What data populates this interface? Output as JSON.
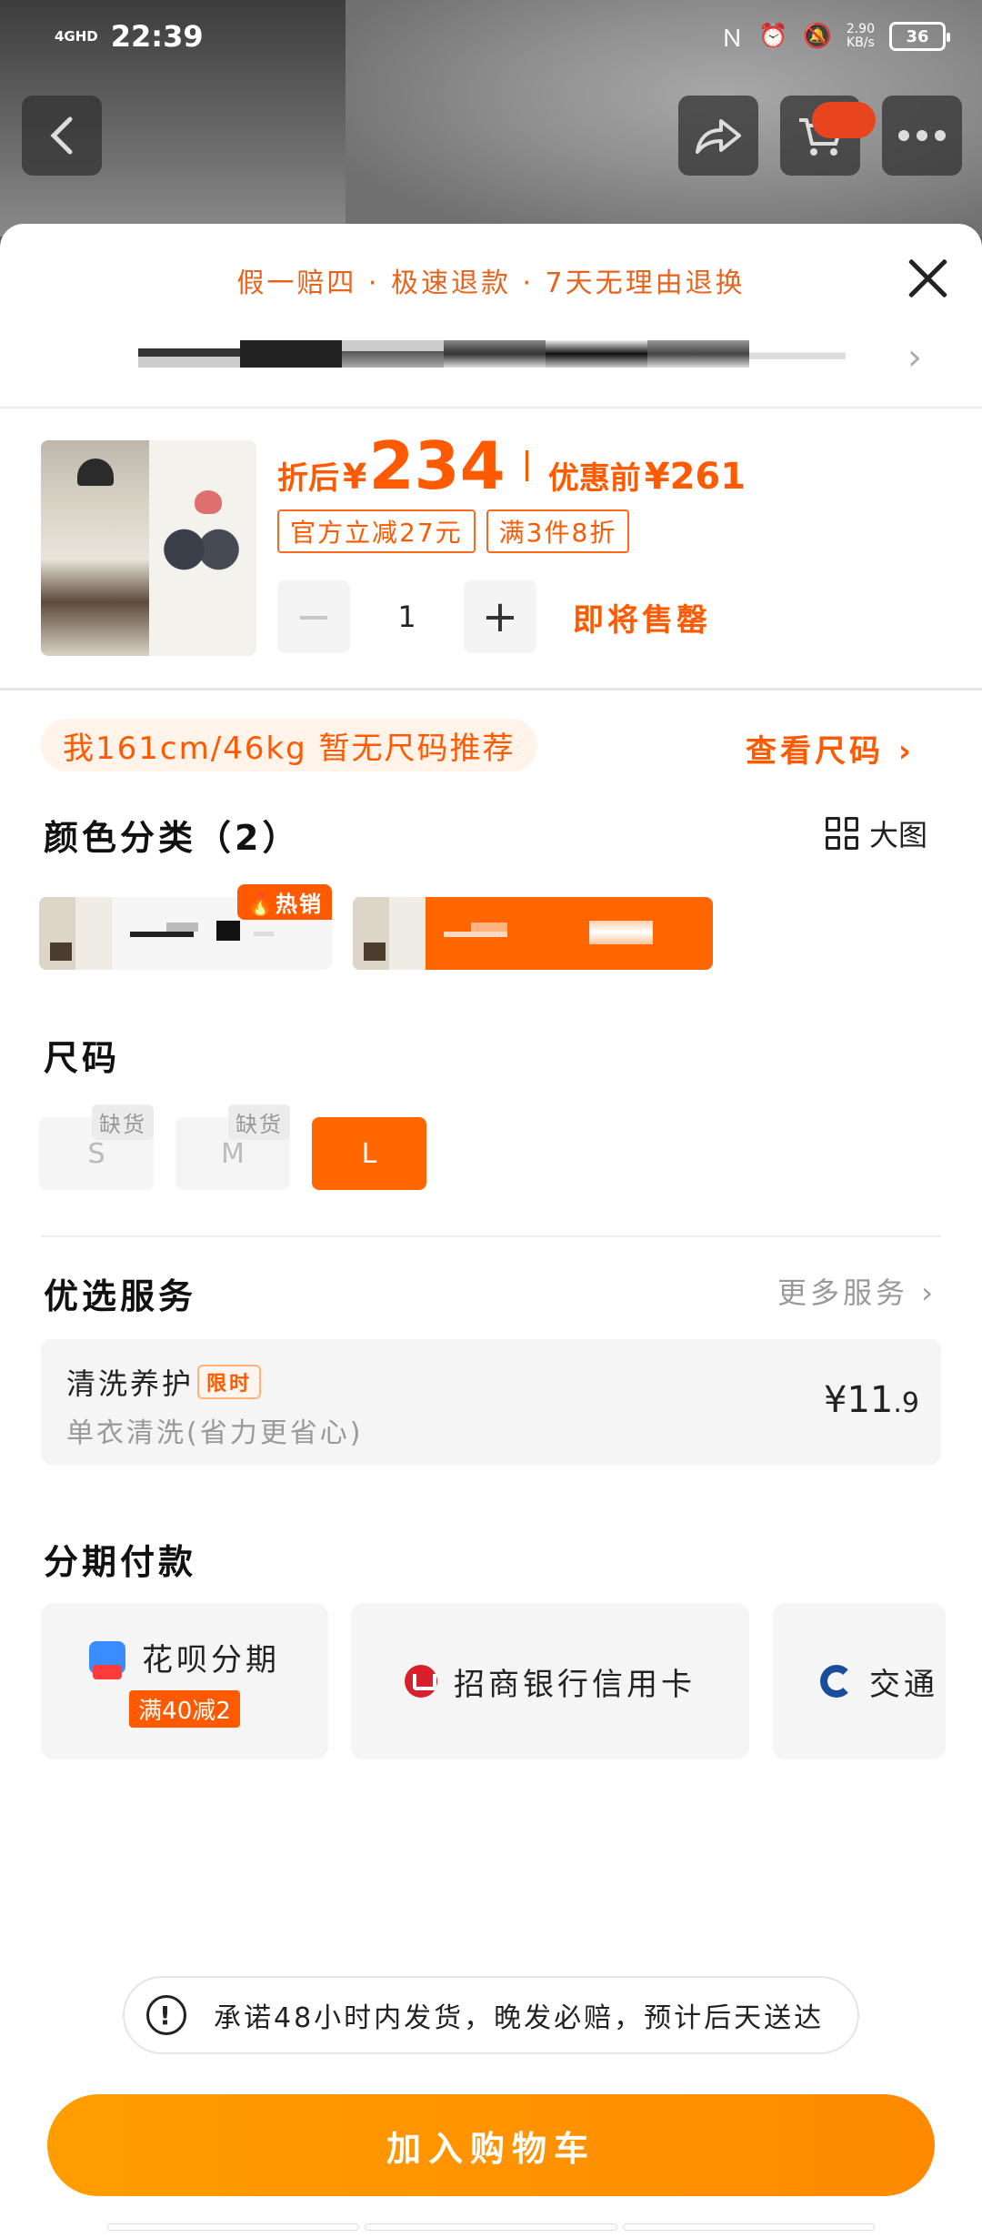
{
  "status_bar": {
    "network": "4GHD",
    "time": "22:39",
    "speed_value": "2.90",
    "speed_unit": "KB/s",
    "battery": "36"
  },
  "sheet": {
    "promise": "假一赔四 · 极速退款 · 7天无理由退换"
  },
  "product": {
    "price_prefix": "折后",
    "currency": "¥",
    "price": "234",
    "orig_prefix": "优惠前",
    "orig_price": "261",
    "tags": [
      "官方立减27元",
      "满3件8折"
    ],
    "quantity": "1",
    "minus": "−",
    "plus": "+",
    "status": "即将售罄"
  },
  "size_tip": "我161cm/46kg 暂无尺码推荐",
  "size_link": "查看尺码",
  "color_section": {
    "title": "颜色分类（2）",
    "big_pic_label": "大图",
    "hot_badge": "热销"
  },
  "size_section": {
    "title": "尺码",
    "sizes": [
      {
        "label": "S",
        "badge": "缺货"
      },
      {
        "label": "M",
        "badge": "缺货"
      },
      {
        "label": "L",
        "badge": ""
      }
    ]
  },
  "service_section": {
    "title": "优选服务",
    "more": "更多服务",
    "item_name": "清洗养护",
    "item_badge": "限时",
    "item_desc": "单衣清洗(省力更省心)",
    "item_price_main": "¥11",
    "item_price_decimal": ".9"
  },
  "installment_section": {
    "title": "分期付款",
    "options": [
      {
        "name": "花呗分期",
        "sub": "满40减2",
        "icon": "huabei-icon"
      },
      {
        "name": "招商银行信用卡",
        "icon": "cmb-bank-icon"
      },
      {
        "name": "交通",
        "icon": "bocom-bank-icon"
      }
    ]
  },
  "notice": "承诺48小时内发货，晚发必赔，预计后天送达",
  "add_to_cart": "加入购物车",
  "colors": {
    "accent": "#FF6600",
    "cta": "#FF9500"
  }
}
